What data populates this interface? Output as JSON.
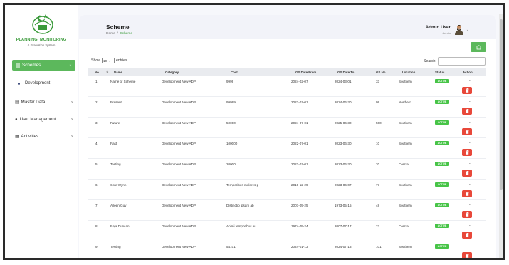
{
  "sidebar": {
    "brand_title": "PLANNING, MONITORING",
    "brand_subtitle": "& Evaluation System",
    "schemes_label": "Schemes",
    "development_label": "Development",
    "master_data_label": "Master Data",
    "user_management_label": "User Management",
    "activities_label": "Activities"
  },
  "header": {
    "title": "Scheme",
    "breadcrumb_home": "Home",
    "breadcrumb_sep": "/",
    "breadcrumb_current": "Scheme",
    "user_name": "Admin User",
    "user_role": "Admin"
  },
  "controls": {
    "show_label": "Show",
    "page_size": "10",
    "entries_label": "entries",
    "search_label": "Search:"
  },
  "table": {
    "columns": [
      "No",
      "Name",
      "Category",
      "Cost",
      "GS Date From",
      "GS Date To",
      "GS No.",
      "Location",
      "Status",
      "Action"
    ],
    "rows": [
      {
        "no": "1",
        "name": "Name of Scheme",
        "category": "Development New ADP",
        "cost": "9999",
        "from": "2024-02-07",
        "to": "2024-03-01",
        "gsno": "33",
        "location": "Southern",
        "status": "ACTIVE"
      },
      {
        "no": "2",
        "name": "Present",
        "category": "Development New ADP",
        "cost": "99999",
        "from": "2023-07-01",
        "to": "2024-06-30",
        "gsno": "99",
        "location": "Northern",
        "status": "ACTIVE"
      },
      {
        "no": "3",
        "name": "Future",
        "category": "Development New ADP",
        "cost": "50000",
        "from": "2024-07-01",
        "to": "2025-06-30",
        "gsno": "500",
        "location": "Southern",
        "status": "ACTIVE"
      },
      {
        "no": "4",
        "name": "Past",
        "category": "Development New ADP",
        "cost": "100000",
        "from": "2022-07-01",
        "to": "2023-06-30",
        "gsno": "10",
        "location": "Southern",
        "status": "ACTIVE"
      },
      {
        "no": "5",
        "name": "Testing",
        "category": "Development New ADP",
        "cost": "20000",
        "from": "2022-07-01",
        "to": "2023-06-30",
        "gsno": "20",
        "location": "Central",
        "status": "ACTIVE"
      },
      {
        "no": "6",
        "name": "Cole Wynn",
        "category": "Development New ADP",
        "cost": "Temporibus molores p",
        "from": "2010-12-29",
        "to": "2023-06-07",
        "gsno": "77",
        "location": "Southern",
        "status": "ACTIVE"
      },
      {
        "no": "7",
        "name": "Aileen Guy",
        "category": "Development New ADP",
        "cost": "Distinctio ipsam ab",
        "from": "2007-05-25",
        "to": "1973-05-15",
        "gsno": "48",
        "location": "Southern",
        "status": "ACTIVE"
      },
      {
        "no": "8",
        "name": "Raja Duncan",
        "category": "Development New ADP",
        "cost": "Animi temporibus eu",
        "from": "1974-05-24",
        "to": "2007-07-17",
        "gsno": "23",
        "location": "Central",
        "status": "ACTIVE"
      },
      {
        "no": "9",
        "name": "Testing",
        "category": "Development New ADP",
        "cost": "54101",
        "from": "2024-01-13",
        "to": "2024-07-13",
        "gsno": "101",
        "location": "Southern",
        "status": "ACTIVE"
      }
    ],
    "action_dash": "-"
  },
  "colors": {
    "accent": "#5cb85c",
    "status_active": "#47c447",
    "delete": "#e8483a"
  },
  "icons": {
    "logo": "seal-logo-icon",
    "add": "add-icon",
    "delete": "trash-icon",
    "sort": "sort-icon"
  }
}
